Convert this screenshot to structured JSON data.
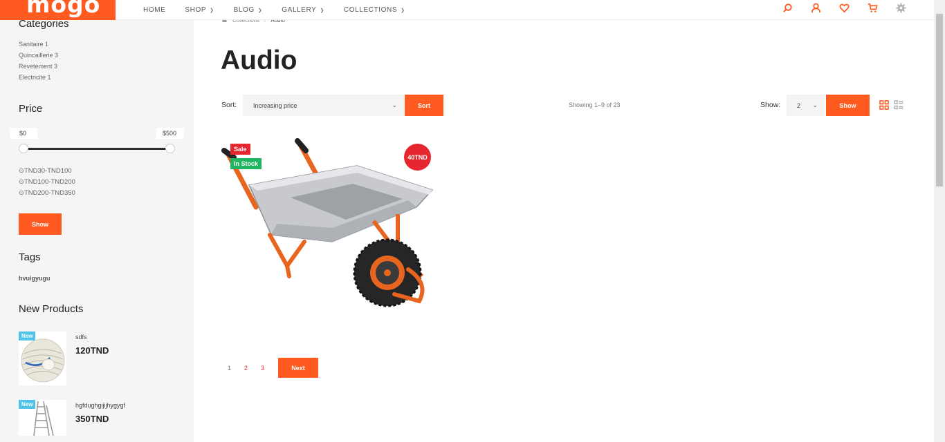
{
  "header": {
    "logo": "mogo",
    "nav": [
      {
        "label": "HOME",
        "dropdown": false
      },
      {
        "label": "SHOP",
        "dropdown": true
      },
      {
        "label": "BLOG",
        "dropdown": true
      },
      {
        "label": "GALLERY",
        "dropdown": true
      },
      {
        "label": "COLLECTIONS",
        "dropdown": true
      }
    ],
    "icons": [
      "search-icon",
      "user-icon",
      "heart-icon",
      "cart-icon",
      "gear-icon"
    ]
  },
  "colors": {
    "accent": "#ff5a1f",
    "sale": "#e5262e",
    "stock": "#1fb45f",
    "new": "#4fc3e8"
  },
  "sidebar": {
    "categories_title": "Categories",
    "categories": [
      "Sanitaire 1",
      "Quincaillerie 3",
      "Revetement 3",
      "Electricite 1"
    ],
    "price_title": "Price",
    "price_min": "$0",
    "price_max": "$500",
    "price_ranges": [
      "⊙TND30-TND100",
      "⊙TND100-TND200",
      "⊙TND200-TND350"
    ],
    "show_button": "Show",
    "tags_title": "Tags",
    "tags": [
      "hvuigyugu"
    ],
    "new_products_title": "New Products",
    "new_products": [
      {
        "badge": "New",
        "name": "sdfs",
        "price": "120TND"
      },
      {
        "badge": "New",
        "name": "hgfdughgijijhygygf",
        "price": "350TND"
      }
    ]
  },
  "breadcrumb": {
    "home_icon": "home-icon",
    "items": [
      "Collections",
      "Audio"
    ]
  },
  "main": {
    "title": "Audio",
    "sort_label": "Sort:",
    "sort_value": "Increasing price",
    "sort_button": "Sort",
    "showing": "Showing 1–9 of 23",
    "show_label": "Show:",
    "show_value": "2",
    "show_button": "Show"
  },
  "product": {
    "sale": "Sale",
    "stock": "In Stock",
    "price": "40TND"
  },
  "pagination": {
    "pages": [
      "1",
      "2",
      "3"
    ],
    "next": "Next"
  }
}
